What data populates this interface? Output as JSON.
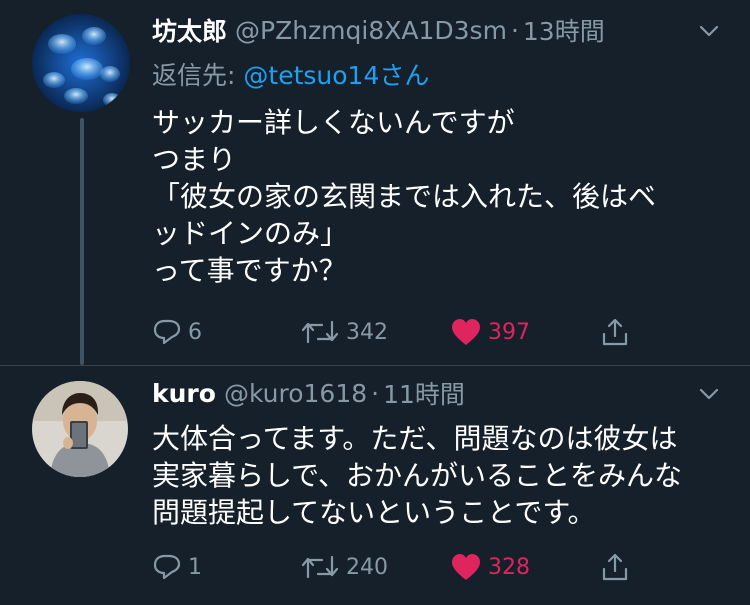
{
  "tweets": [
    {
      "name": "坊太郎",
      "handle": "@PZhzmqi8XA1D3sm",
      "separator": "·",
      "time": "13時間",
      "reply_label": "返信先:",
      "reply_mention": "@tetsuo14さん",
      "text": "サッカー詳しくないんですが\nつまり\n「彼女の家の玄関までは入れた、後はベ\nッドインのみ」\nって事ですか？",
      "replies": "6",
      "retweets": "342",
      "likes": "397",
      "avatar_icon": "jellyfish-avatar"
    },
    {
      "name": "kuro",
      "handle": "@kuro1618",
      "separator": "·",
      "time": "11時間",
      "text": "大体合ってます。ただ、問題なのは彼女は\n実家暮らしで、おかんがいることをみんな\n問題提起してないということです。",
      "replies": "1",
      "retweets": "240",
      "likes": "328",
      "avatar_icon": "person-avatar"
    }
  ],
  "colors": {
    "background": "#15202b",
    "secondary_text": "#8899a6",
    "mention": "#1da1f2",
    "like_active": "#e0245e"
  }
}
